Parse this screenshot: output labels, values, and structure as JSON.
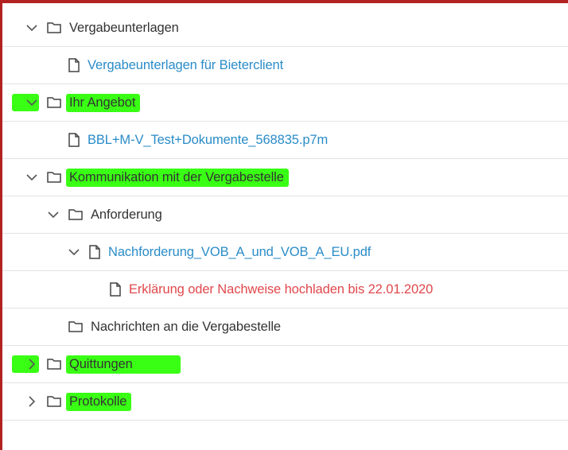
{
  "tree": {
    "rows": [
      {
        "label": "Vergabeunterlagen",
        "kind": "folder",
        "expander": "expanded"
      },
      {
        "label": "Vergabeunterlagen für Bieterclient",
        "kind": "file-link"
      },
      {
        "label": "Ihr Angebot",
        "kind": "folder",
        "expander": "expanded",
        "highlighted": true
      },
      {
        "label": "BBL+M-V_Test+Dokumente_568835.p7m",
        "kind": "file-link"
      },
      {
        "label": "Kommunikation mit der Vergabestelle",
        "kind": "folder",
        "expander": "expanded",
        "highlighted": true
      },
      {
        "label": "Anforderung",
        "kind": "folder",
        "expander": "expanded"
      },
      {
        "label": "Nachforderung_VOB_A_und_VOB_A_EU.pdf",
        "kind": "file-link",
        "expander": "expanded"
      },
      {
        "label": "Erklärung oder Nachweise hochladen bis 22.01.2020",
        "kind": "file-warning"
      },
      {
        "label": "Nachrichten an die Vergabestelle",
        "kind": "folder"
      },
      {
        "label": "Quittungen",
        "kind": "folder",
        "expander": "collapsed",
        "highlighted": true
      },
      {
        "label": "Protokolle",
        "kind": "folder",
        "expander": "collapsed",
        "highlighted": true
      }
    ]
  },
  "colors": {
    "link": "#2a8cc8",
    "warning": "#e0484c",
    "text": "#333333",
    "highlight": "#39ff14",
    "frame": "#b22222"
  },
  "icons": {
    "folder": "folder-icon",
    "file": "file-icon",
    "expanded": "chevron-down-icon",
    "collapsed": "chevron-right-icon"
  }
}
